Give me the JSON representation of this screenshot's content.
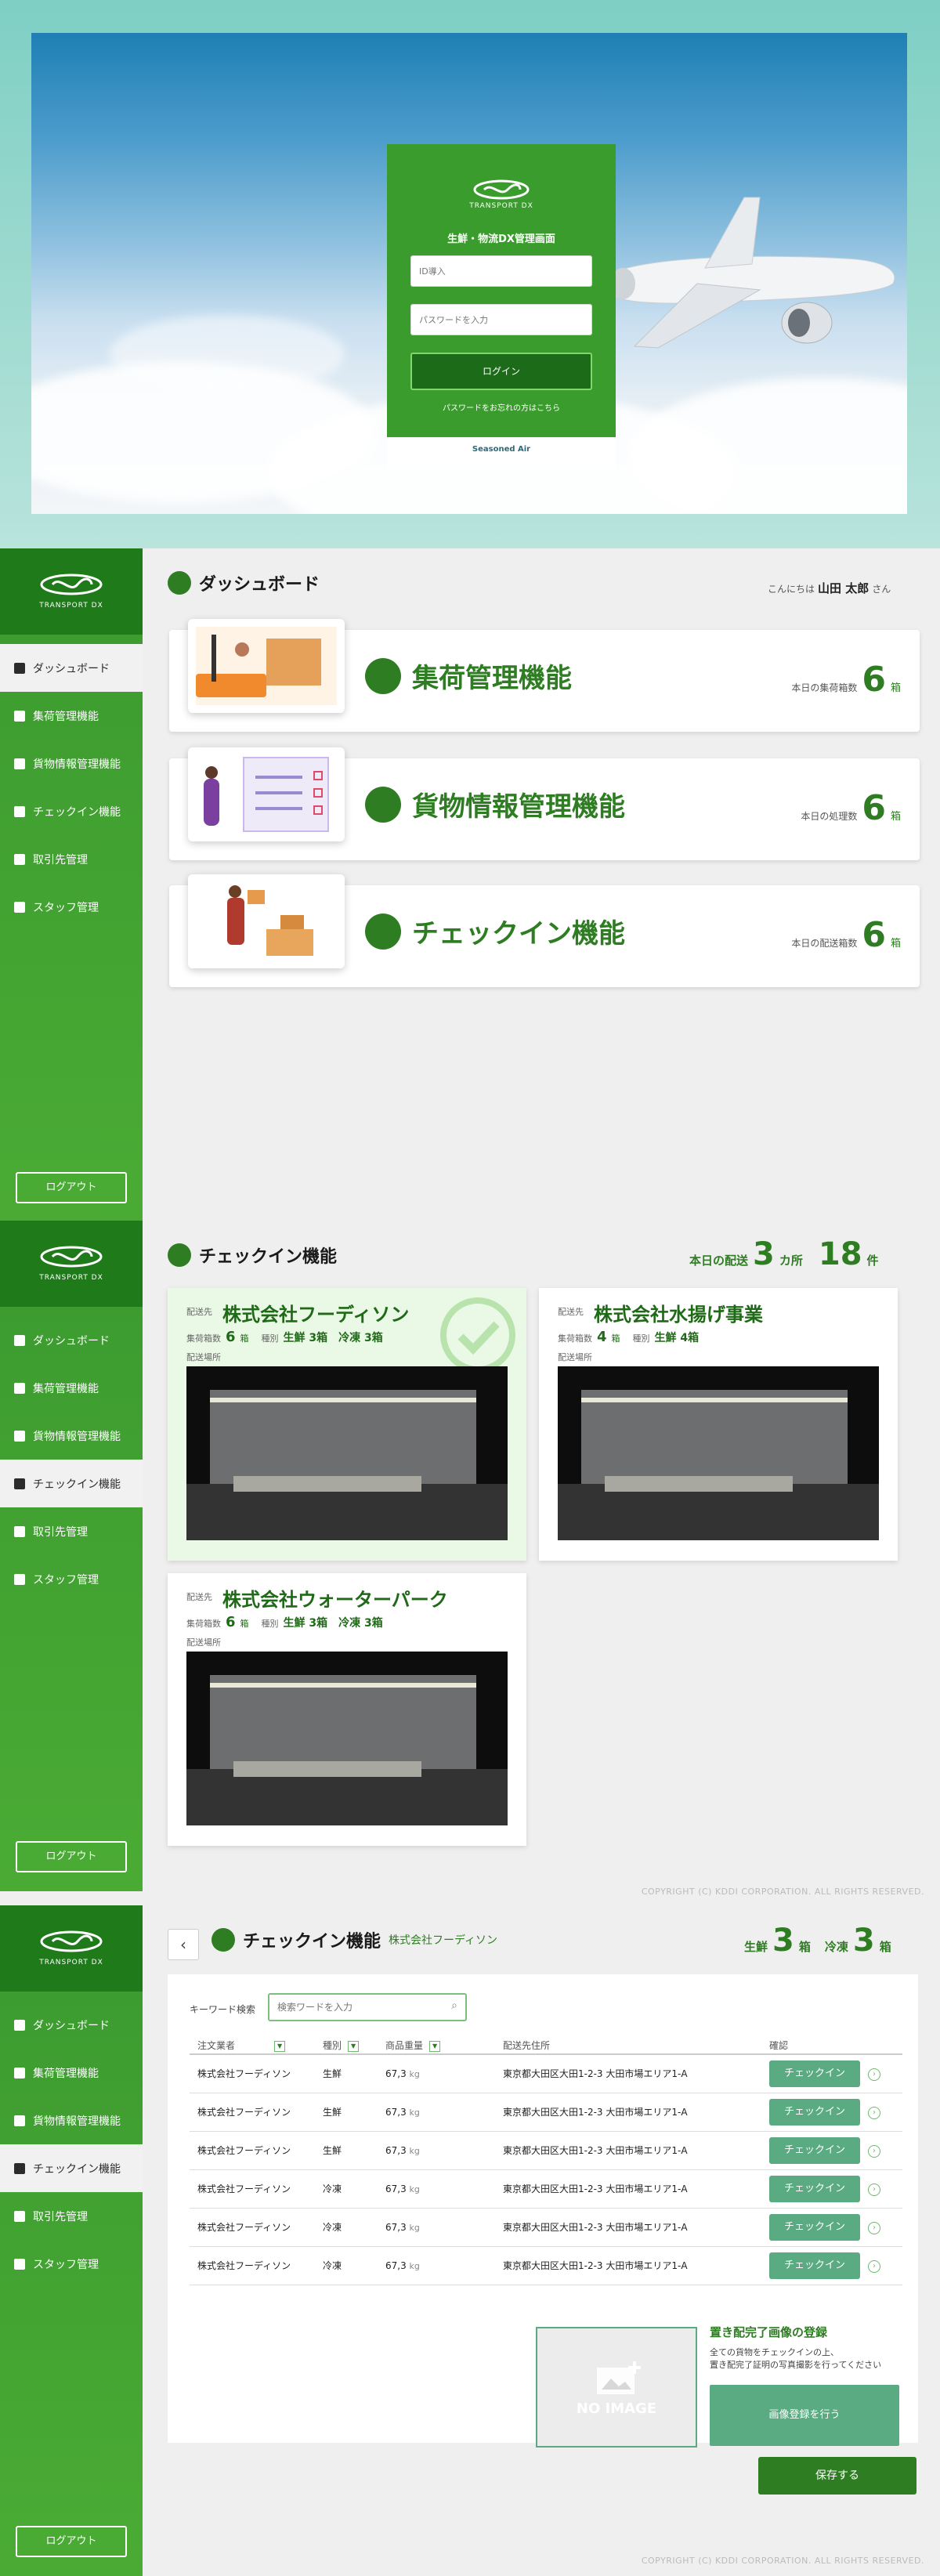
{
  "login": {
    "brand": "TRANSPORT DX",
    "title": "生鮮・物流DX管理画面",
    "id_placeholder": "ID導入",
    "password_placeholder": "パスワードを入力",
    "login_button": "ログイン",
    "forgot_link": "パスワードをお忘れの方はこちら",
    "footer_logo": "Seasoned Air"
  },
  "brand": "TRANSPORT DX",
  "nav": [
    "ダッシュボード",
    "集荷管理機能",
    "貨物情報管理機能",
    "チェックイン機能",
    "取引先管理",
    "スタッフ管理"
  ],
  "logout": "ログアウト",
  "dashboard": {
    "title": "ダッシュボード",
    "greeting_prefix": "こんにちは",
    "user_name": "山田 太郎",
    "greeting_suffix": "さん",
    "cards": [
      {
        "name": "集荷管理機能",
        "stat_label": "本日の集荷箱数",
        "value": "6",
        "unit": "箱"
      },
      {
        "name": "貨物情報管理機能",
        "stat_label": "本日の処理数",
        "value": "6",
        "unit": "箱"
      },
      {
        "name": "チェックイン機能",
        "stat_label": "本日の配送箱数",
        "value": "6",
        "unit": "箱"
      }
    ]
  },
  "checkin": {
    "title": "チェックイン機能",
    "summary_label": "本日の配送",
    "places": "3",
    "places_unit": "カ所",
    "items": "18",
    "items_unit": "件",
    "dest_label": "配送先",
    "count_label": "集荷箱数",
    "type_label": "種別",
    "place_label": "配送場所",
    "destinations": [
      {
        "name": "株式会社フーディソン",
        "boxes": "6",
        "box_unit": "箱",
        "types": "生鮮 3箱　冷凍 3箱",
        "done": true
      },
      {
        "name": "株式会社水揚げ事業",
        "boxes": "4",
        "box_unit": "箱",
        "types": "生鮮 4箱",
        "done": false
      },
      {
        "name": "株式会社ウォーターパーク",
        "boxes": "6",
        "box_unit": "箱",
        "types": "生鮮 3箱　冷凍 3箱",
        "done": false
      }
    ]
  },
  "detail": {
    "title": "チェックイン機能",
    "company": "株式会社フーディソン",
    "fresh_label": "生鮮",
    "fresh_count": "3",
    "frozen_label": "冷凍",
    "frozen_count": "3",
    "unit": "箱",
    "search_label": "キーワード検索",
    "search_placeholder": "検索ワードを入力",
    "columns": [
      "注文業者",
      "種別",
      "商品重量",
      "配送先住所",
      "確認"
    ],
    "rows": [
      {
        "vendor": "株式会社フーディソン",
        "type": "生鮮",
        "weight": "67,3",
        "wunit": "kg",
        "address": "東京都大田区大田1-2-3 大田市場エリア1-A",
        "action": "チェックイン"
      },
      {
        "vendor": "株式会社フーディソン",
        "type": "生鮮",
        "weight": "67,3",
        "wunit": "kg",
        "address": "東京都大田区大田1-2-3 大田市場エリア1-A",
        "action": "チェックイン"
      },
      {
        "vendor": "株式会社フーディソン",
        "type": "生鮮",
        "weight": "67,3",
        "wunit": "kg",
        "address": "東京都大田区大田1-2-3 大田市場エリア1-A",
        "action": "チェックイン"
      },
      {
        "vendor": "株式会社フーディソン",
        "type": "冷凍",
        "weight": "67,3",
        "wunit": "kg",
        "address": "東京都大田区大田1-2-3 大田市場エリア1-A",
        "action": "チェックイン"
      },
      {
        "vendor": "株式会社フーディソン",
        "type": "冷凍",
        "weight": "67,3",
        "wunit": "kg",
        "address": "東京都大田区大田1-2-3 大田市場エリア1-A",
        "action": "チェックイン"
      },
      {
        "vendor": "株式会社フーディソン",
        "type": "冷凍",
        "weight": "67,3",
        "wunit": "kg",
        "address": "東京都大田区大田1-2-3 大田市場エリア1-A",
        "action": "チェックイン"
      }
    ],
    "no_image": "NO IMAGE",
    "upload_title": "置き配完了画像の登録",
    "upload_desc1": "全ての貨物をチェックインの上、",
    "upload_desc2": "置き配完了証明の写真撮影を行ってください",
    "upload_button": "画像登録を行う",
    "save_button": "保存する"
  },
  "copyright": "COPYRIGHT (C) KDDI CORPORATION. ALL RIGHTS RESERVED.",
  "colors": {
    "primary": "#2e7d22",
    "sidebar": "#3f9f30",
    "accent": "#5aaa82"
  }
}
